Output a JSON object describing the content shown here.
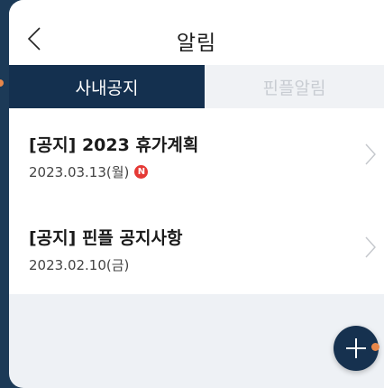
{
  "header": {
    "title": "알림",
    "back_icon": "chevron-left-icon"
  },
  "tabs": [
    {
      "label": "사내공지",
      "active": true
    },
    {
      "label": "핀플알림",
      "active": false
    }
  ],
  "notices": [
    {
      "title": "[공지] 2023 휴가계획",
      "date": "2023.03.13(월)",
      "is_new": true,
      "badge": "N"
    },
    {
      "title": "[공지] 핀플 공지사항",
      "date": "2023.02.10(금)",
      "is_new": false
    }
  ],
  "fab": {
    "icon": "plus-icon"
  },
  "colors": {
    "navy": "#14304f",
    "badge_red": "#e53935",
    "accent_orange": "#e8874a"
  }
}
